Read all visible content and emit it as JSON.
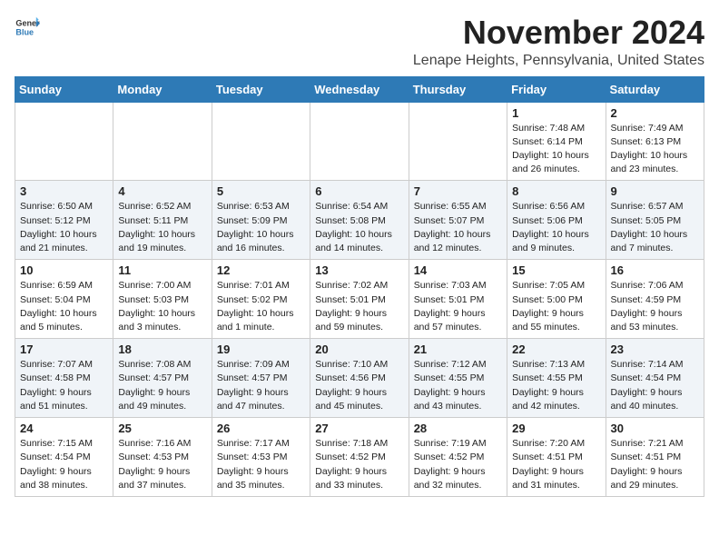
{
  "header": {
    "logo_general": "General",
    "logo_blue": "Blue",
    "title": "November 2024",
    "subtitle": "Lenape Heights, Pennsylvania, United States"
  },
  "days_of_week": [
    "Sunday",
    "Monday",
    "Tuesday",
    "Wednesday",
    "Thursday",
    "Friday",
    "Saturday"
  ],
  "weeks": [
    [
      {
        "day": "",
        "info": ""
      },
      {
        "day": "",
        "info": ""
      },
      {
        "day": "",
        "info": ""
      },
      {
        "day": "",
        "info": ""
      },
      {
        "day": "",
        "info": ""
      },
      {
        "day": "1",
        "info": "Sunrise: 7:48 AM\nSunset: 6:14 PM\nDaylight: 10 hours and 26 minutes."
      },
      {
        "day": "2",
        "info": "Sunrise: 7:49 AM\nSunset: 6:13 PM\nDaylight: 10 hours and 23 minutes."
      }
    ],
    [
      {
        "day": "3",
        "info": "Sunrise: 6:50 AM\nSunset: 5:12 PM\nDaylight: 10 hours and 21 minutes."
      },
      {
        "day": "4",
        "info": "Sunrise: 6:52 AM\nSunset: 5:11 PM\nDaylight: 10 hours and 19 minutes."
      },
      {
        "day": "5",
        "info": "Sunrise: 6:53 AM\nSunset: 5:09 PM\nDaylight: 10 hours and 16 minutes."
      },
      {
        "day": "6",
        "info": "Sunrise: 6:54 AM\nSunset: 5:08 PM\nDaylight: 10 hours and 14 minutes."
      },
      {
        "day": "7",
        "info": "Sunrise: 6:55 AM\nSunset: 5:07 PM\nDaylight: 10 hours and 12 minutes."
      },
      {
        "day": "8",
        "info": "Sunrise: 6:56 AM\nSunset: 5:06 PM\nDaylight: 10 hours and 9 minutes."
      },
      {
        "day": "9",
        "info": "Sunrise: 6:57 AM\nSunset: 5:05 PM\nDaylight: 10 hours and 7 minutes."
      }
    ],
    [
      {
        "day": "10",
        "info": "Sunrise: 6:59 AM\nSunset: 5:04 PM\nDaylight: 10 hours and 5 minutes."
      },
      {
        "day": "11",
        "info": "Sunrise: 7:00 AM\nSunset: 5:03 PM\nDaylight: 10 hours and 3 minutes."
      },
      {
        "day": "12",
        "info": "Sunrise: 7:01 AM\nSunset: 5:02 PM\nDaylight: 10 hours and 1 minute."
      },
      {
        "day": "13",
        "info": "Sunrise: 7:02 AM\nSunset: 5:01 PM\nDaylight: 9 hours and 59 minutes."
      },
      {
        "day": "14",
        "info": "Sunrise: 7:03 AM\nSunset: 5:01 PM\nDaylight: 9 hours and 57 minutes."
      },
      {
        "day": "15",
        "info": "Sunrise: 7:05 AM\nSunset: 5:00 PM\nDaylight: 9 hours and 55 minutes."
      },
      {
        "day": "16",
        "info": "Sunrise: 7:06 AM\nSunset: 4:59 PM\nDaylight: 9 hours and 53 minutes."
      }
    ],
    [
      {
        "day": "17",
        "info": "Sunrise: 7:07 AM\nSunset: 4:58 PM\nDaylight: 9 hours and 51 minutes."
      },
      {
        "day": "18",
        "info": "Sunrise: 7:08 AM\nSunset: 4:57 PM\nDaylight: 9 hours and 49 minutes."
      },
      {
        "day": "19",
        "info": "Sunrise: 7:09 AM\nSunset: 4:57 PM\nDaylight: 9 hours and 47 minutes."
      },
      {
        "day": "20",
        "info": "Sunrise: 7:10 AM\nSunset: 4:56 PM\nDaylight: 9 hours and 45 minutes."
      },
      {
        "day": "21",
        "info": "Sunrise: 7:12 AM\nSunset: 4:55 PM\nDaylight: 9 hours and 43 minutes."
      },
      {
        "day": "22",
        "info": "Sunrise: 7:13 AM\nSunset: 4:55 PM\nDaylight: 9 hours and 42 minutes."
      },
      {
        "day": "23",
        "info": "Sunrise: 7:14 AM\nSunset: 4:54 PM\nDaylight: 9 hours and 40 minutes."
      }
    ],
    [
      {
        "day": "24",
        "info": "Sunrise: 7:15 AM\nSunset: 4:54 PM\nDaylight: 9 hours and 38 minutes."
      },
      {
        "day": "25",
        "info": "Sunrise: 7:16 AM\nSunset: 4:53 PM\nDaylight: 9 hours and 37 minutes."
      },
      {
        "day": "26",
        "info": "Sunrise: 7:17 AM\nSunset: 4:53 PM\nDaylight: 9 hours and 35 minutes."
      },
      {
        "day": "27",
        "info": "Sunrise: 7:18 AM\nSunset: 4:52 PM\nDaylight: 9 hours and 33 minutes."
      },
      {
        "day": "28",
        "info": "Sunrise: 7:19 AM\nSunset: 4:52 PM\nDaylight: 9 hours and 32 minutes."
      },
      {
        "day": "29",
        "info": "Sunrise: 7:20 AM\nSunset: 4:51 PM\nDaylight: 9 hours and 31 minutes."
      },
      {
        "day": "30",
        "info": "Sunrise: 7:21 AM\nSunset: 4:51 PM\nDaylight: 9 hours and 29 minutes."
      }
    ]
  ]
}
